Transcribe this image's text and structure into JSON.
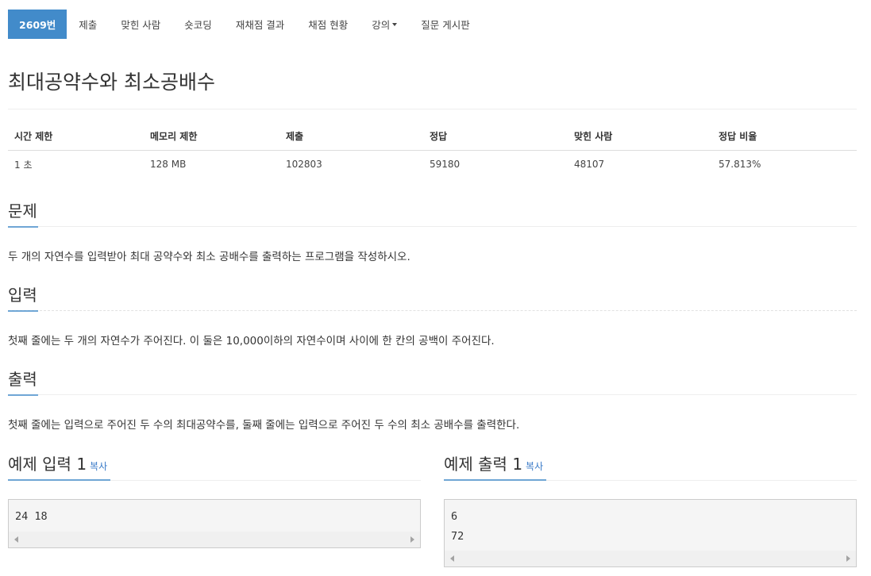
{
  "nav": {
    "items": [
      {
        "label": "2609번",
        "active": true
      },
      {
        "label": "제출"
      },
      {
        "label": "맞힌 사람"
      },
      {
        "label": "숏코딩"
      },
      {
        "label": "재채점 결과"
      },
      {
        "label": "채점 현황"
      },
      {
        "label": "강의",
        "dropdown": true
      },
      {
        "label": "질문 게시판"
      }
    ]
  },
  "problem": {
    "title": "최대공약수와 최소공배수"
  },
  "info_table": {
    "headers": [
      "시간 제한",
      "메모리 제한",
      "제출",
      "정답",
      "맞힌 사람",
      "정답 비율"
    ],
    "values": [
      "1 초",
      "128 MB",
      "102803",
      "59180",
      "48107",
      "57.813%"
    ]
  },
  "sections": {
    "description": {
      "heading": "문제",
      "text": "두 개의 자연수를 입력받아 최대 공약수와 최소 공배수를 출력하는 프로그램을 작성하시오."
    },
    "input": {
      "heading": "입력",
      "text": "첫째 줄에는 두 개의 자연수가 주어진다. 이 둘은 10,000이하의 자연수이며 사이에 한 칸의 공백이 주어진다."
    },
    "output": {
      "heading": "출력",
      "text": "첫째 줄에는 입력으로 주어진 두 수의 최대공약수를, 둘째 줄에는 입력으로 주어진 두 수의 최소 공배수를 출력한다."
    }
  },
  "samples": {
    "input": {
      "heading": "예제 입력 1",
      "copy_label": "복사",
      "content": "24 18"
    },
    "output": {
      "heading": "예제 출력 1",
      "copy_label": "복사",
      "content": "6\n72"
    }
  },
  "colors": {
    "accent": "#428bca",
    "link": "#3a7bc8",
    "sample_bg": "#f5f5f5",
    "rule": "#eeeeee"
  }
}
